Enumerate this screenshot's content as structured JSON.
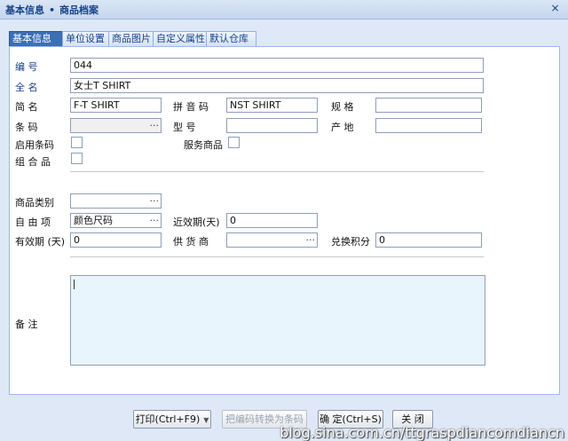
{
  "window": {
    "breadcrumb_1": "基本信息",
    "breadcrumb_sep": "•",
    "breadcrumb_2": "商品档案",
    "close_glyph": "×"
  },
  "tabs": [
    {
      "label": "基本信息",
      "active": true
    },
    {
      "label": "单位设置"
    },
    {
      "label": "商品图片"
    },
    {
      "label": "自定义属性"
    },
    {
      "label": "默认仓库"
    }
  ],
  "form": {
    "code_label": "编    号",
    "code_value": "044",
    "fullname_label": "全    名",
    "fullname_value": "女士T SHIRT",
    "shortname_label": "简    名",
    "shortname_value": "F-T SHIRT",
    "pinyin_label": "拼 音 码",
    "pinyin_value": "NST SHIRT",
    "spec_label": "规    格",
    "spec_value": "",
    "barcode_label": "条    码",
    "barcode_value": "",
    "model_label": "型    号",
    "model_value": "",
    "origin_label": "产    地",
    "origin_value": "",
    "enable_barcode_label": "启用条码",
    "service_goods_label": "服务商品",
    "combo_label": "组 合 品",
    "category_label": "商品类别",
    "category_value": "",
    "free_item_label": "自 由 项",
    "free_item_value": "颜色尺码",
    "near_expiry_label": "近效期(天)",
    "near_expiry_value": "0",
    "validity_label": "有效期 (天)",
    "validity_value": "0",
    "supplier_label": "供 货 商",
    "supplier_value": "",
    "points_label": "兑换积分",
    "points_value": "0",
    "memo_label": "备    注",
    "memo_value": "",
    "dots": "···"
  },
  "buttons": {
    "print_label": "打印(Ctrl+F9)",
    "convert_label": "把编码转换为条码",
    "ok_label": "确 定(Ctrl+S)",
    "close_label": "关 闭",
    "dropdown_glyph": "▼"
  },
  "watermark": "blog.sina.com.cn/ttgraspdiancomdiancn"
}
